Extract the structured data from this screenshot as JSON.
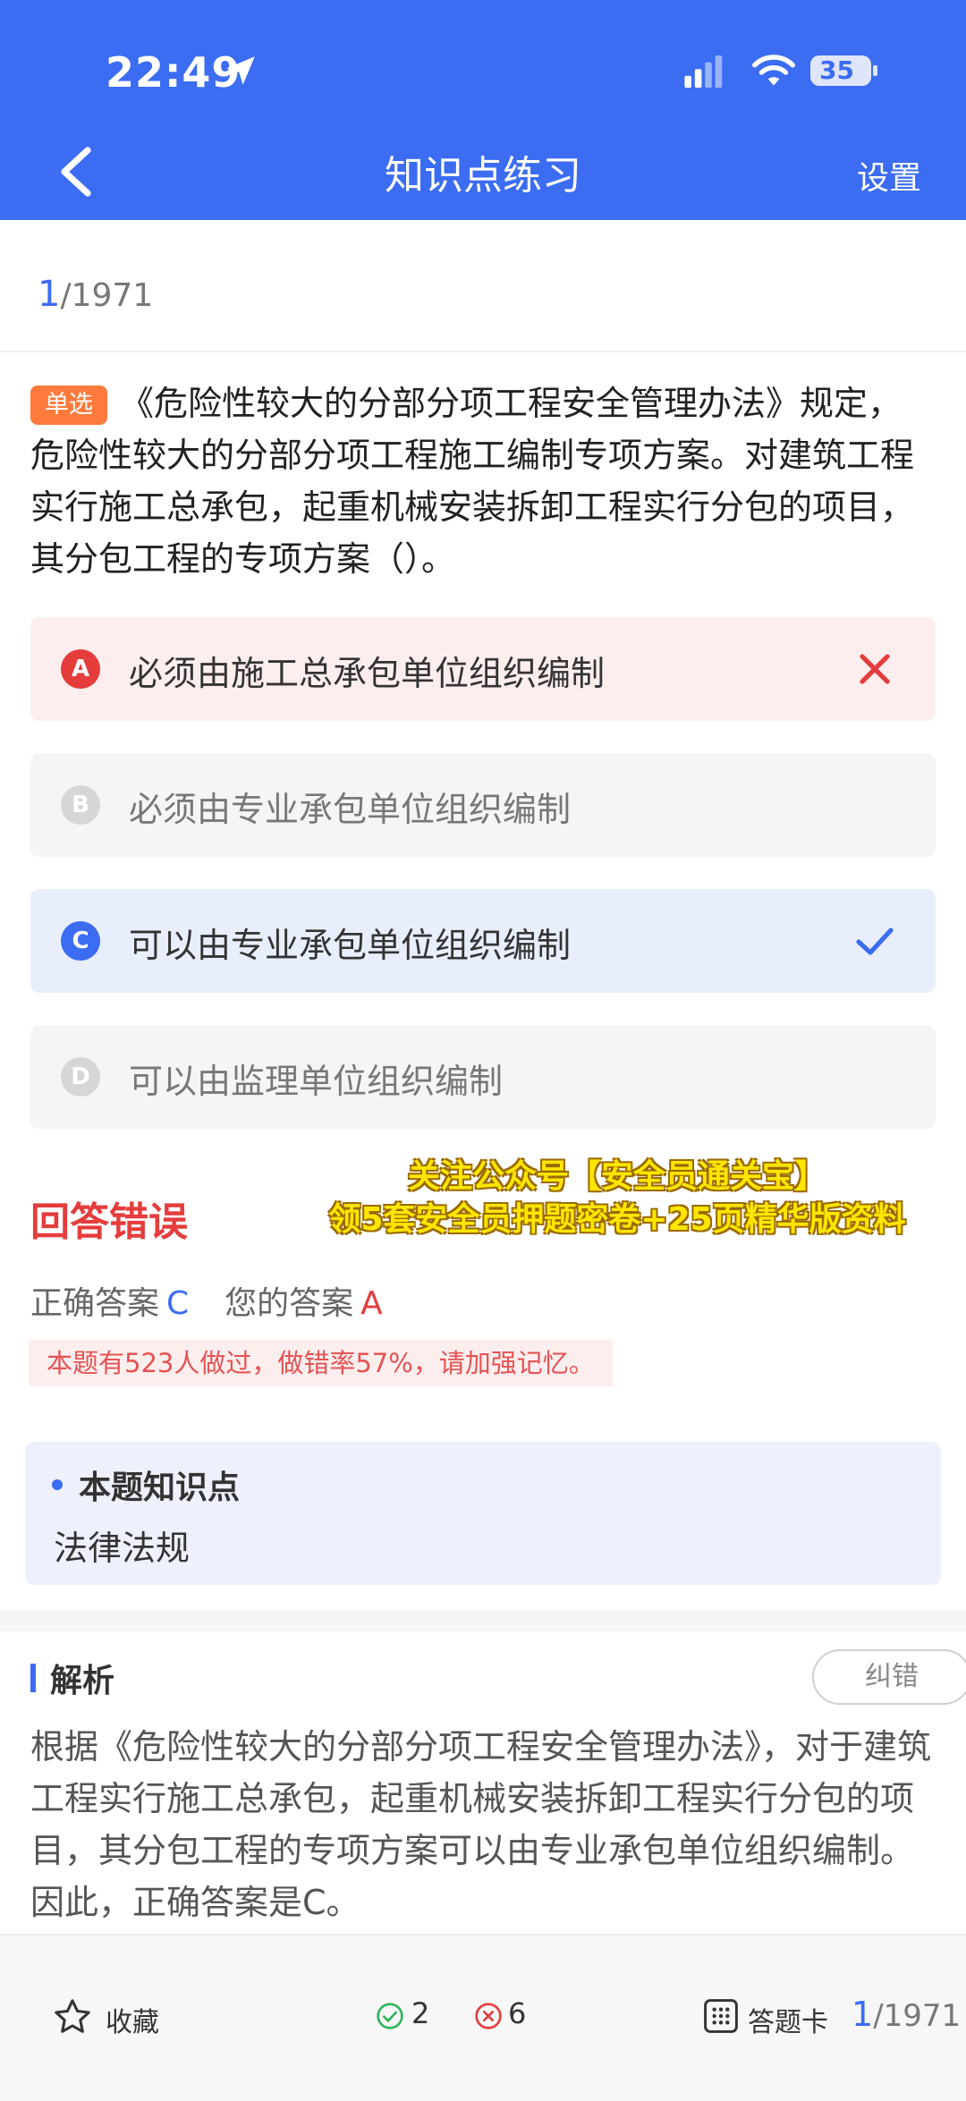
{
  "status": {
    "time": "22:49",
    "battery": "35"
  },
  "header": {
    "title": "知识点练习",
    "settings": "设置"
  },
  "progress": {
    "current": "1",
    "total": "/1971"
  },
  "question": {
    "type": "单选",
    "text": "《危险性较大的分部分项工程安全管理办法》规定，危险性较大的分部分项工程施工编制专项方案。对建筑工程实行施工总承包，起重机械安装拆卸工程实行分包的项目，其分包工程的专项方案（）。"
  },
  "options": [
    {
      "letter": "A",
      "text": "必须由施工总承包单位组织编制",
      "state": "wrong"
    },
    {
      "letter": "B",
      "text": "必须由专业承包单位组织编制",
      "state": "normal"
    },
    {
      "letter": "C",
      "text": "可以由专业承包单位组织编制",
      "state": "correct"
    },
    {
      "letter": "D",
      "text": "可以由监理单位组织编制",
      "state": "normal"
    }
  ],
  "result": {
    "label": "回答错误",
    "correct_label": "正确答案",
    "correct_value": "C",
    "your_label": "您的答案",
    "your_value": "A",
    "stats": "本题有523人做过，做错率57%，请加强记忆。"
  },
  "promo": {
    "line1": "关注公众号【安全员通关宝】",
    "line2": "领5套安全员押题密卷+25页精华版资料"
  },
  "knowledge": {
    "title": "本题知识点",
    "value": "法律法规"
  },
  "analysis": {
    "title": "解析",
    "correct_button": "纠错",
    "text": "根据《危险性较大的分部分项工程安全管理办法》，对于建筑工程实行施工总承包，起重机械安装拆卸工程实行分包的项目，其分包工程的专项方案可以由专业承包单位组织编制。因此，正确答案是C。"
  },
  "bottom": {
    "favorite": "收藏",
    "right_count": "2",
    "wrong_count": "6",
    "answer_card": "答题卡",
    "current": "1",
    "total": "/1971"
  },
  "colors": {
    "primary": "#3b6cf2",
    "wrong": "#e53c3c",
    "question_tag": "#ff7a3d"
  }
}
